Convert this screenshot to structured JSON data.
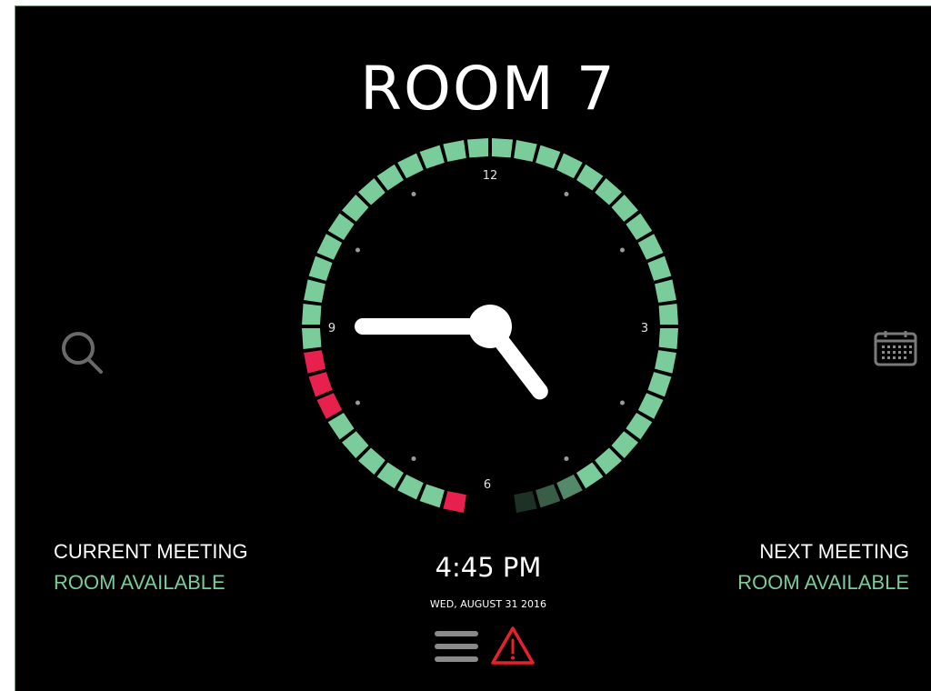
{
  "room": {
    "title": "ROOM 7"
  },
  "clock": {
    "numerals": {
      "twelve": "12",
      "three": "3",
      "six": "6",
      "nine": "9"
    },
    "hands": {
      "hour": "4:45",
      "minute": "45"
    },
    "colors": {
      "available": "#7acc9b",
      "booked": "#e8204e",
      "face": "#000000",
      "hand": "#ffffff"
    }
  },
  "current_meeting": {
    "label": "CURRENT MEETING",
    "status": "ROOM AVAILABLE"
  },
  "next_meeting": {
    "label": "NEXT MEETING",
    "status": "ROOM AVAILABLE"
  },
  "time": {
    "display": "4:45 PM",
    "date": "WED, AUGUST 31 2016"
  },
  "icons": {
    "search": "search-icon",
    "calendar": "calendar-icon",
    "menu": "menu-icon",
    "alert": "warning-icon"
  }
}
